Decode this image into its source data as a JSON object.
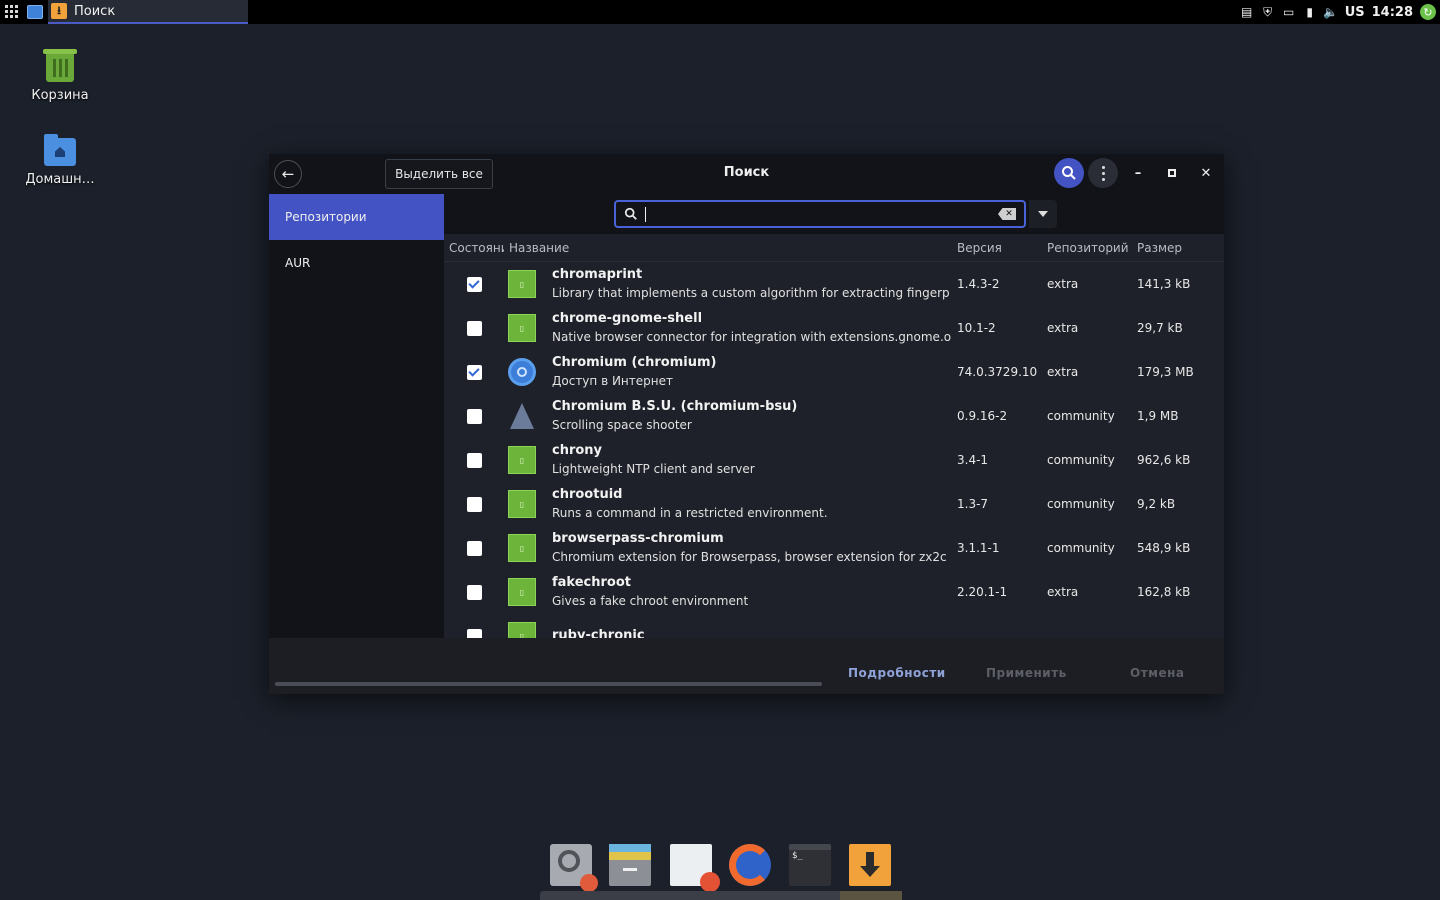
{
  "panel": {
    "active_task": "Поиск",
    "tray": {
      "keyboard_layout": "US",
      "clock": "14:28",
      "icons": [
        "clipboard-icon",
        "shield-icon",
        "screen-icon",
        "battery-icon",
        "volume-icon",
        "updates-icon"
      ]
    }
  },
  "desktop": {
    "icons": [
      {
        "label": "Корзина",
        "icon": "trash-icon"
      },
      {
        "label": "Домашн…",
        "icon": "home-folder-icon"
      }
    ]
  },
  "window": {
    "title": "Поиск",
    "select_all_label": "Выделить все",
    "sidebar": [
      {
        "label": "Репозитории",
        "active": true
      },
      {
        "label": "AUR",
        "active": false
      }
    ],
    "search": {
      "value": "",
      "placeholder": ""
    },
    "columns": {
      "state": "Состояние",
      "name": "Название",
      "version": "Версия",
      "repo": "Репозиторий",
      "size": "Размер"
    },
    "packages": [
      {
        "name": "chromaprint",
        "desc": "Library that implements a custom algorithm for extracting fingerp",
        "version": "1.4.3-2",
        "repo": "extra",
        "size": "141,3 kB",
        "installed": true,
        "icon": "package-icon"
      },
      {
        "name": "chrome-gnome-shell",
        "desc": "Native browser connector for integration with extensions.gnome.o",
        "version": "10.1-2",
        "repo": "extra",
        "size": "29,7 kB",
        "installed": false,
        "icon": "package-icon"
      },
      {
        "name": "Chromium  (chromium)",
        "desc": "Доступ в Интернет",
        "version": "74.0.3729.10",
        "repo": "extra",
        "size": "179,3 MB",
        "installed": true,
        "icon": "chromium-icon"
      },
      {
        "name": "Chromium B.S.U.  (chromium-bsu)",
        "desc": "Scrolling space shooter",
        "version": "0.9.16-2",
        "repo": "community",
        "size": "1,9 MB",
        "installed": false,
        "icon": "spaceship-icon"
      },
      {
        "name": "chrony",
        "desc": "Lightweight NTP client and server",
        "version": "3.4-1",
        "repo": "community",
        "size": "962,6 kB",
        "installed": false,
        "icon": "package-icon"
      },
      {
        "name": "chrootuid",
        "desc": "Runs a command in a restricted environment.",
        "version": "1.3-7",
        "repo": "community",
        "size": "9,2 kB",
        "installed": false,
        "icon": "package-icon"
      },
      {
        "name": "browserpass-chromium",
        "desc": "Chromium extension for Browserpass, browser extension for zx2c",
        "version": "3.1.1-1",
        "repo": "community",
        "size": "548,9 kB",
        "installed": false,
        "icon": "package-icon"
      },
      {
        "name": "fakechroot",
        "desc": "Gives a fake chroot environment",
        "version": "2.20.1-1",
        "repo": "extra",
        "size": "162,8 kB",
        "installed": false,
        "icon": "package-icon"
      },
      {
        "name": "ruby-chronic",
        "desc": "",
        "version": "",
        "repo": "",
        "size": "",
        "installed": false,
        "icon": "package-icon"
      }
    ],
    "footer": {
      "details_label": "Подробности",
      "apply_label": "Применить",
      "cancel_label": "Отмена"
    }
  },
  "dock": [
    "disk-utility-icon",
    "file-manager-icon",
    "text-editor-icon",
    "firefox-icon",
    "terminal-icon",
    "package-manager-icon"
  ],
  "colors": {
    "accent": "#4353c4",
    "desktop_bg": "#1b202a",
    "panel_bg": "#000000"
  }
}
